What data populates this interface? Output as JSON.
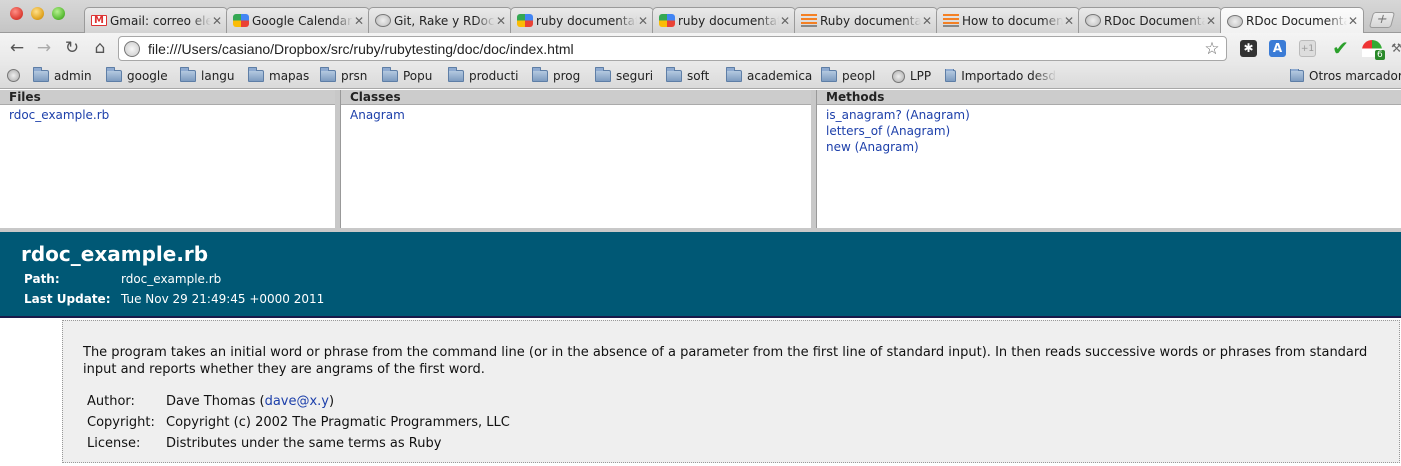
{
  "browser": {
    "tabs": [
      {
        "title": "Gmail: correo electrónico",
        "favicon": "gmail-icon",
        "active": false
      },
      {
        "title": "Google Calendar",
        "favicon": "google-calendar-icon",
        "active": false
      },
      {
        "title": "Git, Rake y RDoc",
        "favicon": "globe-icon",
        "active": false
      },
      {
        "title": "ruby documentation",
        "favicon": "google-icon",
        "active": false
      },
      {
        "title": "ruby documentation",
        "favicon": "google-icon",
        "active": false
      },
      {
        "title": "Ruby documentation",
        "favicon": "stackoverflow-icon",
        "active": false
      },
      {
        "title": "How to document",
        "favicon": "stackoverflow-icon",
        "active": false
      },
      {
        "title": "RDoc Documentation",
        "favicon": "globe-icon",
        "active": false
      },
      {
        "title": "RDoc Documentation",
        "favicon": "globe-icon",
        "active": true
      }
    ],
    "url": "file:///Users/casiano/Dropbox/src/ruby/rubytesting/doc/doc/index.html",
    "extension_badge": "6"
  },
  "bookmarks": [
    {
      "label": "admin",
      "icon": "folder-icon"
    },
    {
      "label": "google",
      "icon": "folder-icon"
    },
    {
      "label": "langu",
      "icon": "folder-icon"
    },
    {
      "label": "mapas",
      "icon": "folder-icon"
    },
    {
      "label": "prsn",
      "icon": "folder-icon"
    },
    {
      "label": "Popu",
      "icon": "folder-icon"
    },
    {
      "label": "producti",
      "icon": "folder-icon"
    },
    {
      "label": "prog",
      "icon": "folder-icon"
    },
    {
      "label": "seguri",
      "icon": "folder-icon"
    },
    {
      "label": "soft",
      "icon": "folder-icon"
    },
    {
      "label": "academica",
      "icon": "folder-icon"
    },
    {
      "label": "peopl",
      "icon": "folder-icon"
    },
    {
      "label": "LPP",
      "icon": "globe-icon"
    },
    {
      "label": "Importado desde Firefox",
      "icon": "folder-icon"
    },
    {
      "label": "Otros marcadores",
      "icon": "folder-icon"
    }
  ],
  "frames": {
    "files": {
      "header": "Files",
      "items": [
        "rdoc_example.rb"
      ]
    },
    "classes": {
      "header": "Classes",
      "items": [
        "Anagram"
      ]
    },
    "methods": {
      "header": "Methods",
      "items": [
        "is_anagram? (Anagram)",
        "letters_of (Anagram)",
        "new (Anagram)"
      ]
    }
  },
  "doc": {
    "title": "rdoc_example.rb",
    "path_label": "Path:",
    "path_value": "rdoc_example.rb",
    "update_label": "Last Update:",
    "update_value": "Tue Nov 29 21:49:45 +0000 2011",
    "description": "The program takes an initial word or phrase from the command line (or in the absence of a parameter from the first line of standard input). In then reads successive words or phrases from standard input and reports whether they are angrams of the first word.",
    "author_label": "Author:",
    "author_name": "Dave Thomas",
    "author_email": "dave@x.y",
    "copyright_label": "Copyright:",
    "copyright_value": "Copyright (c) 2002 The Pragmatic Programmers, LLC",
    "license_label": "License:",
    "license_value": "Distributes under the same terms as Ruby"
  },
  "colors": {
    "header_bg": "#005875",
    "link": "#1c3faa",
    "frame_header_bg": "#cccccc",
    "description_bg": "#efefef"
  }
}
